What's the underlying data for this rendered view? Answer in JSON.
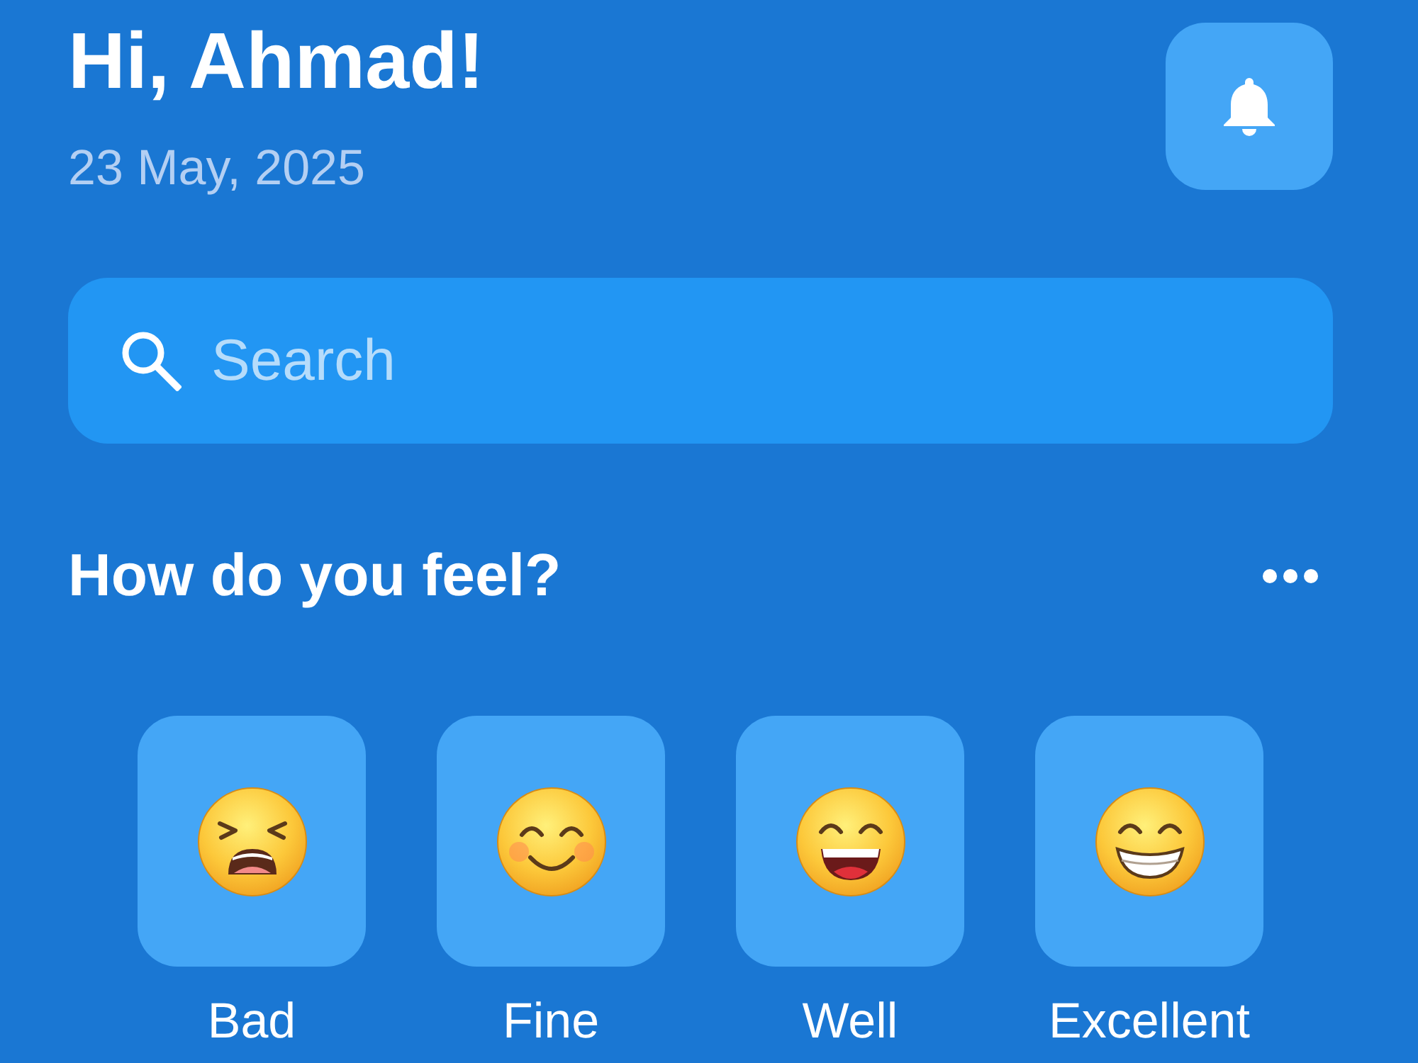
{
  "header": {
    "greeting": "Hi, Ahmad!",
    "date": "23 May, 2025"
  },
  "search": {
    "placeholder": "Search"
  },
  "mood_section": {
    "title": "How do you feel?",
    "moods": [
      {
        "label": "Bad",
        "kind": "tired"
      },
      {
        "label": "Fine",
        "kind": "blushing"
      },
      {
        "label": "Well",
        "kind": "laughing"
      },
      {
        "label": "Excellent",
        "kind": "grinning"
      }
    ]
  }
}
